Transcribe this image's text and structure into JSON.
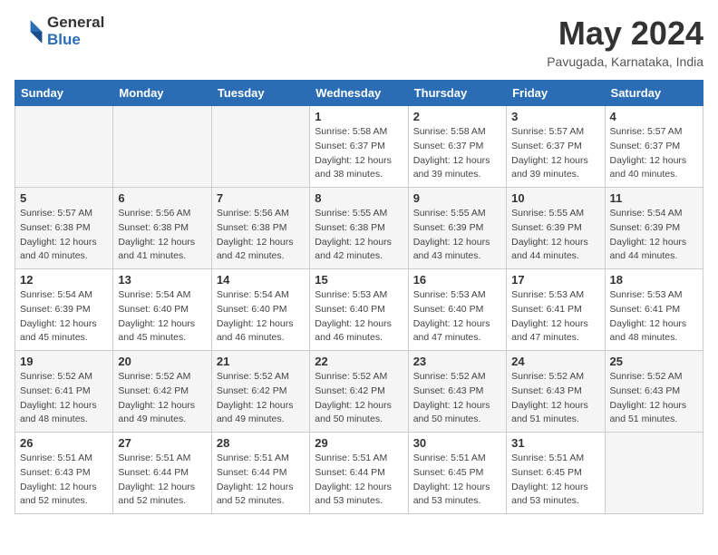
{
  "header": {
    "logo_general": "General",
    "logo_blue": "Blue",
    "month_year": "May 2024",
    "location": "Pavugada, Karnataka, India"
  },
  "days_of_week": [
    "Sunday",
    "Monday",
    "Tuesday",
    "Wednesday",
    "Thursday",
    "Friday",
    "Saturday"
  ],
  "weeks": [
    [
      {
        "day": "",
        "info": ""
      },
      {
        "day": "",
        "info": ""
      },
      {
        "day": "",
        "info": ""
      },
      {
        "day": "1",
        "info": "Sunrise: 5:58 AM\nSunset: 6:37 PM\nDaylight: 12 hours\nand 38 minutes."
      },
      {
        "day": "2",
        "info": "Sunrise: 5:58 AM\nSunset: 6:37 PM\nDaylight: 12 hours\nand 39 minutes."
      },
      {
        "day": "3",
        "info": "Sunrise: 5:57 AM\nSunset: 6:37 PM\nDaylight: 12 hours\nand 39 minutes."
      },
      {
        "day": "4",
        "info": "Sunrise: 5:57 AM\nSunset: 6:37 PM\nDaylight: 12 hours\nand 40 minutes."
      }
    ],
    [
      {
        "day": "5",
        "info": "Sunrise: 5:57 AM\nSunset: 6:38 PM\nDaylight: 12 hours\nand 40 minutes."
      },
      {
        "day": "6",
        "info": "Sunrise: 5:56 AM\nSunset: 6:38 PM\nDaylight: 12 hours\nand 41 minutes."
      },
      {
        "day": "7",
        "info": "Sunrise: 5:56 AM\nSunset: 6:38 PM\nDaylight: 12 hours\nand 42 minutes."
      },
      {
        "day": "8",
        "info": "Sunrise: 5:55 AM\nSunset: 6:38 PM\nDaylight: 12 hours\nand 42 minutes."
      },
      {
        "day": "9",
        "info": "Sunrise: 5:55 AM\nSunset: 6:39 PM\nDaylight: 12 hours\nand 43 minutes."
      },
      {
        "day": "10",
        "info": "Sunrise: 5:55 AM\nSunset: 6:39 PM\nDaylight: 12 hours\nand 44 minutes."
      },
      {
        "day": "11",
        "info": "Sunrise: 5:54 AM\nSunset: 6:39 PM\nDaylight: 12 hours\nand 44 minutes."
      }
    ],
    [
      {
        "day": "12",
        "info": "Sunrise: 5:54 AM\nSunset: 6:39 PM\nDaylight: 12 hours\nand 45 minutes."
      },
      {
        "day": "13",
        "info": "Sunrise: 5:54 AM\nSunset: 6:40 PM\nDaylight: 12 hours\nand 45 minutes."
      },
      {
        "day": "14",
        "info": "Sunrise: 5:54 AM\nSunset: 6:40 PM\nDaylight: 12 hours\nand 46 minutes."
      },
      {
        "day": "15",
        "info": "Sunrise: 5:53 AM\nSunset: 6:40 PM\nDaylight: 12 hours\nand 46 minutes."
      },
      {
        "day": "16",
        "info": "Sunrise: 5:53 AM\nSunset: 6:40 PM\nDaylight: 12 hours\nand 47 minutes."
      },
      {
        "day": "17",
        "info": "Sunrise: 5:53 AM\nSunset: 6:41 PM\nDaylight: 12 hours\nand 47 minutes."
      },
      {
        "day": "18",
        "info": "Sunrise: 5:53 AM\nSunset: 6:41 PM\nDaylight: 12 hours\nand 48 minutes."
      }
    ],
    [
      {
        "day": "19",
        "info": "Sunrise: 5:52 AM\nSunset: 6:41 PM\nDaylight: 12 hours\nand 48 minutes."
      },
      {
        "day": "20",
        "info": "Sunrise: 5:52 AM\nSunset: 6:42 PM\nDaylight: 12 hours\nand 49 minutes."
      },
      {
        "day": "21",
        "info": "Sunrise: 5:52 AM\nSunset: 6:42 PM\nDaylight: 12 hours\nand 49 minutes."
      },
      {
        "day": "22",
        "info": "Sunrise: 5:52 AM\nSunset: 6:42 PM\nDaylight: 12 hours\nand 50 minutes."
      },
      {
        "day": "23",
        "info": "Sunrise: 5:52 AM\nSunset: 6:43 PM\nDaylight: 12 hours\nand 50 minutes."
      },
      {
        "day": "24",
        "info": "Sunrise: 5:52 AM\nSunset: 6:43 PM\nDaylight: 12 hours\nand 51 minutes."
      },
      {
        "day": "25",
        "info": "Sunrise: 5:52 AM\nSunset: 6:43 PM\nDaylight: 12 hours\nand 51 minutes."
      }
    ],
    [
      {
        "day": "26",
        "info": "Sunrise: 5:51 AM\nSunset: 6:43 PM\nDaylight: 12 hours\nand 52 minutes."
      },
      {
        "day": "27",
        "info": "Sunrise: 5:51 AM\nSunset: 6:44 PM\nDaylight: 12 hours\nand 52 minutes."
      },
      {
        "day": "28",
        "info": "Sunrise: 5:51 AM\nSunset: 6:44 PM\nDaylight: 12 hours\nand 52 minutes."
      },
      {
        "day": "29",
        "info": "Sunrise: 5:51 AM\nSunset: 6:44 PM\nDaylight: 12 hours\nand 53 minutes."
      },
      {
        "day": "30",
        "info": "Sunrise: 5:51 AM\nSunset: 6:45 PM\nDaylight: 12 hours\nand 53 minutes."
      },
      {
        "day": "31",
        "info": "Sunrise: 5:51 AM\nSunset: 6:45 PM\nDaylight: 12 hours\nand 53 minutes."
      },
      {
        "day": "",
        "info": ""
      }
    ]
  ]
}
